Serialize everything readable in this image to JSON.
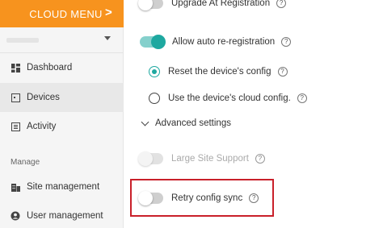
{
  "sidebar": {
    "cloud_menu_label": "CLOUD MENU",
    "cloud_menu_chevron": ">",
    "nav": [
      {
        "label": "Dashboard",
        "icon": "dashboard-icon"
      },
      {
        "label": "Devices",
        "icon": "device-icon"
      },
      {
        "label": "Activity",
        "icon": "activity-icon"
      }
    ],
    "section_manage": "Manage",
    "manage_items": [
      {
        "label": "Site management",
        "icon": "site-icon"
      },
      {
        "label": "User management",
        "icon": "user-icon"
      }
    ]
  },
  "settings": {
    "upgrade_at_registration": "Upgrade At Registration",
    "allow_auto_reregistration": "Allow auto re-registration",
    "reset_device_config": "Reset the device's config",
    "use_cloud_config": "Use the device's cloud config.",
    "advanced_settings": "Advanced settings",
    "large_site_support": "Large Site Support",
    "retry_config_sync": "Retry config sync",
    "help_glyph": "?"
  },
  "colors": {
    "accent_orange": "#f7931e",
    "toggle_on": "#1ea8a0",
    "highlight_red": "#c9202a"
  }
}
